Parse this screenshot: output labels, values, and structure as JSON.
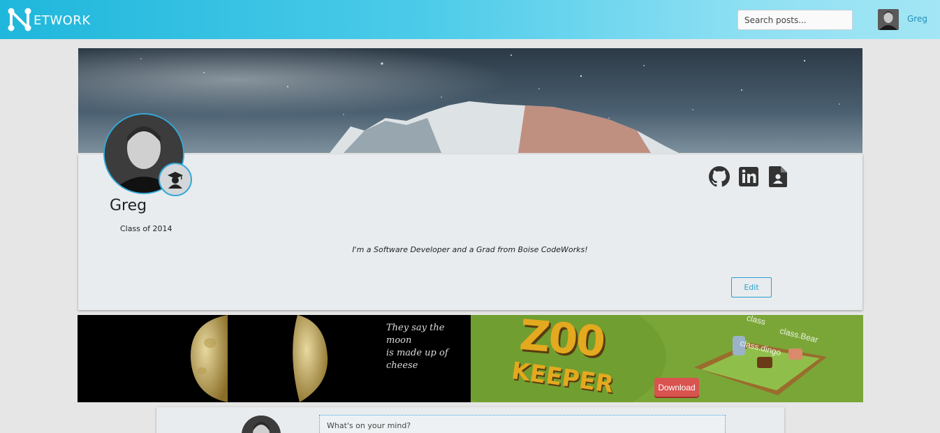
{
  "navbar": {
    "brand_letter": "N",
    "brand_text": "ETWORK",
    "search_placeholder": "Search posts...",
    "user_name": "Greg"
  },
  "profile": {
    "name": "Greg",
    "class_of": "Class of 2014",
    "bio": "I'm a Software Developer and a Grad from Boise CodeWorks!",
    "edit_label": "Edit",
    "badge_icon": "graduate-icon",
    "social_icons": [
      "github-icon",
      "linkedin-icon",
      "resume-icon"
    ]
  },
  "ads": {
    "left_text_line1": "They say the moon",
    "left_text_line2": "is made up of cheese",
    "right_title_top": "Z00",
    "right_title_bottom": "KEEPER",
    "right_download": "Download",
    "right_labels": [
      "class.Bear",
      "class.dingo",
      "class"
    ]
  },
  "composer": {
    "placeholder": "What's on your mind?"
  },
  "colors": {
    "accent": "#2a9fce",
    "navbar_start": "#1fb7dc",
    "navbar_end": "#a3e6f5",
    "card_bg": "#e8ecef",
    "page_bg": "#e6e6e6"
  }
}
